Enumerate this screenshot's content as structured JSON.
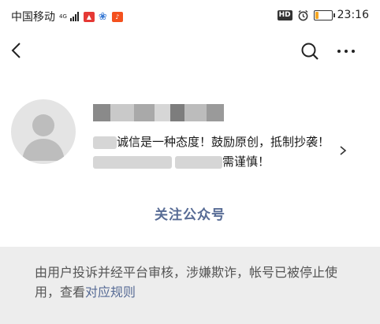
{
  "status_bar": {
    "carrier": "中国移动",
    "network_top": "4G",
    "network_bottom": "HD",
    "time": "23:16",
    "battery_level": 0.2,
    "colors": {
      "app1": "#e53935",
      "app2": "#3a7bd5",
      "app3": "#f4511e"
    },
    "icons": [
      "signal-icon",
      "app-notification-icon",
      "baidu-icon",
      "music-app-icon",
      "hd-icon",
      "alarm-icon",
      "battery-icon"
    ]
  },
  "nav": {
    "icons": [
      "back-icon",
      "search-icon",
      "more-icon"
    ]
  },
  "profile": {
    "intro_before": "诚信是一种态度！鼓励原创，抵制抄袭！",
    "intro_after": "需谨慎！",
    "follow_label": "关注公众号"
  },
  "notice": {
    "text": "由用户投诉并经平台审核，涉嫌欺诈，帐号已被停止使用，查看",
    "link": "对应规则"
  },
  "colors": {
    "link": "#576b95",
    "notice_bg": "#ededed"
  }
}
